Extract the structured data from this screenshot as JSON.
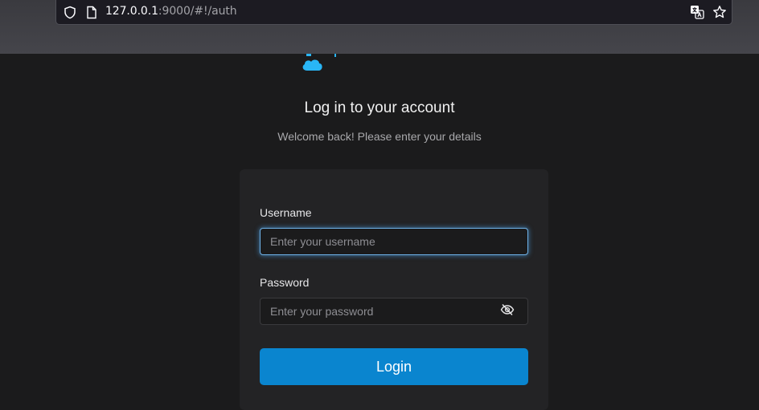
{
  "browser": {
    "url_host": "127.0.0.1",
    "url_rest": ":9000/#!/auth"
  },
  "auth": {
    "title": "Log in to your account",
    "subtitle": "Welcome back! Please enter your details",
    "username_label": "Username",
    "username_placeholder": "Enter your username",
    "password_label": "Password",
    "password_placeholder": "Enter your password",
    "login_label": "Login"
  },
  "colors": {
    "accent": "#0a85cf",
    "logo": "#29b6f6",
    "background": "#1b1b1c",
    "card": "#232325"
  }
}
